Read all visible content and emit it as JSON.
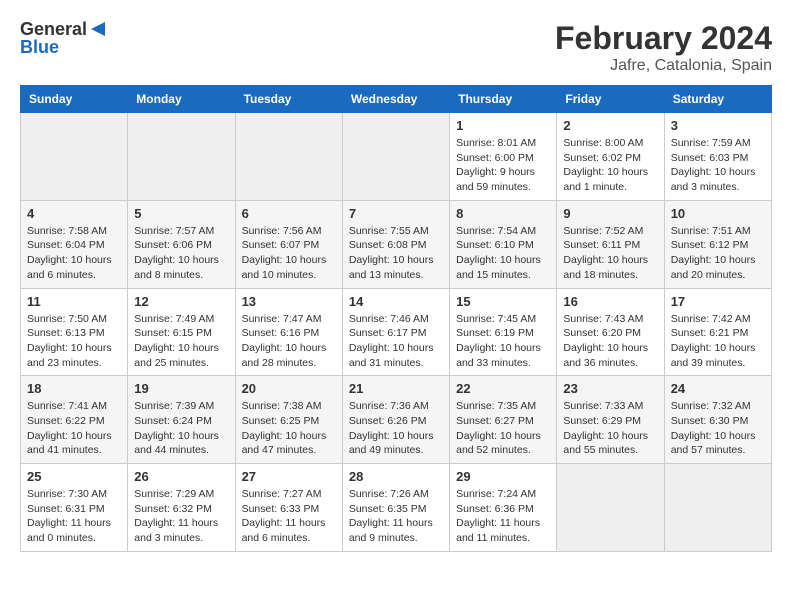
{
  "header": {
    "logo_general": "General",
    "logo_blue": "Blue",
    "title": "February 2024",
    "subtitle": "Jafre, Catalonia, Spain"
  },
  "calendar": {
    "days_of_week": [
      "Sunday",
      "Monday",
      "Tuesday",
      "Wednesday",
      "Thursday",
      "Friday",
      "Saturday"
    ],
    "weeks": [
      [
        {
          "day": "",
          "info": ""
        },
        {
          "day": "",
          "info": ""
        },
        {
          "day": "",
          "info": ""
        },
        {
          "day": "",
          "info": ""
        },
        {
          "day": "1",
          "info": "Sunrise: 8:01 AM\nSunset: 6:00 PM\nDaylight: 9 hours and 59 minutes."
        },
        {
          "day": "2",
          "info": "Sunrise: 8:00 AM\nSunset: 6:02 PM\nDaylight: 10 hours and 1 minute."
        },
        {
          "day": "3",
          "info": "Sunrise: 7:59 AM\nSunset: 6:03 PM\nDaylight: 10 hours and 3 minutes."
        }
      ],
      [
        {
          "day": "4",
          "info": "Sunrise: 7:58 AM\nSunset: 6:04 PM\nDaylight: 10 hours and 6 minutes."
        },
        {
          "day": "5",
          "info": "Sunrise: 7:57 AM\nSunset: 6:06 PM\nDaylight: 10 hours and 8 minutes."
        },
        {
          "day": "6",
          "info": "Sunrise: 7:56 AM\nSunset: 6:07 PM\nDaylight: 10 hours and 10 minutes."
        },
        {
          "day": "7",
          "info": "Sunrise: 7:55 AM\nSunset: 6:08 PM\nDaylight: 10 hours and 13 minutes."
        },
        {
          "day": "8",
          "info": "Sunrise: 7:54 AM\nSunset: 6:10 PM\nDaylight: 10 hours and 15 minutes."
        },
        {
          "day": "9",
          "info": "Sunrise: 7:52 AM\nSunset: 6:11 PM\nDaylight: 10 hours and 18 minutes."
        },
        {
          "day": "10",
          "info": "Sunrise: 7:51 AM\nSunset: 6:12 PM\nDaylight: 10 hours and 20 minutes."
        }
      ],
      [
        {
          "day": "11",
          "info": "Sunrise: 7:50 AM\nSunset: 6:13 PM\nDaylight: 10 hours and 23 minutes."
        },
        {
          "day": "12",
          "info": "Sunrise: 7:49 AM\nSunset: 6:15 PM\nDaylight: 10 hours and 25 minutes."
        },
        {
          "day": "13",
          "info": "Sunrise: 7:47 AM\nSunset: 6:16 PM\nDaylight: 10 hours and 28 minutes."
        },
        {
          "day": "14",
          "info": "Sunrise: 7:46 AM\nSunset: 6:17 PM\nDaylight: 10 hours and 31 minutes."
        },
        {
          "day": "15",
          "info": "Sunrise: 7:45 AM\nSunset: 6:19 PM\nDaylight: 10 hours and 33 minutes."
        },
        {
          "day": "16",
          "info": "Sunrise: 7:43 AM\nSunset: 6:20 PM\nDaylight: 10 hours and 36 minutes."
        },
        {
          "day": "17",
          "info": "Sunrise: 7:42 AM\nSunset: 6:21 PM\nDaylight: 10 hours and 39 minutes."
        }
      ],
      [
        {
          "day": "18",
          "info": "Sunrise: 7:41 AM\nSunset: 6:22 PM\nDaylight: 10 hours and 41 minutes."
        },
        {
          "day": "19",
          "info": "Sunrise: 7:39 AM\nSunset: 6:24 PM\nDaylight: 10 hours and 44 minutes."
        },
        {
          "day": "20",
          "info": "Sunrise: 7:38 AM\nSunset: 6:25 PM\nDaylight: 10 hours and 47 minutes."
        },
        {
          "day": "21",
          "info": "Sunrise: 7:36 AM\nSunset: 6:26 PM\nDaylight: 10 hours and 49 minutes."
        },
        {
          "day": "22",
          "info": "Sunrise: 7:35 AM\nSunset: 6:27 PM\nDaylight: 10 hours and 52 minutes."
        },
        {
          "day": "23",
          "info": "Sunrise: 7:33 AM\nSunset: 6:29 PM\nDaylight: 10 hours and 55 minutes."
        },
        {
          "day": "24",
          "info": "Sunrise: 7:32 AM\nSunset: 6:30 PM\nDaylight: 10 hours and 57 minutes."
        }
      ],
      [
        {
          "day": "25",
          "info": "Sunrise: 7:30 AM\nSunset: 6:31 PM\nDaylight: 11 hours and 0 minutes."
        },
        {
          "day": "26",
          "info": "Sunrise: 7:29 AM\nSunset: 6:32 PM\nDaylight: 11 hours and 3 minutes."
        },
        {
          "day": "27",
          "info": "Sunrise: 7:27 AM\nSunset: 6:33 PM\nDaylight: 11 hours and 6 minutes."
        },
        {
          "day": "28",
          "info": "Sunrise: 7:26 AM\nSunset: 6:35 PM\nDaylight: 11 hours and 9 minutes."
        },
        {
          "day": "29",
          "info": "Sunrise: 7:24 AM\nSunset: 6:36 PM\nDaylight: 11 hours and 11 minutes."
        },
        {
          "day": "",
          "info": ""
        },
        {
          "day": "",
          "info": ""
        }
      ]
    ]
  }
}
